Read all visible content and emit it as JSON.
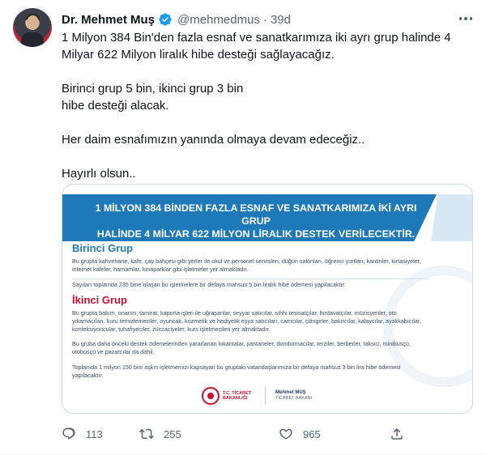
{
  "tweet": {
    "author_name": "Dr. Mehmet Muş",
    "handle": "@mehmedmus",
    "separator": "·",
    "time": "39d",
    "lines": [
      "1 Milyon 384 Bin'den fazla esnaf ve sanatkarımıza iki ayrı grup halinde 4",
      "Milyar 622 Milyon liralık hibe desteği sağlayacağız.",
      "Birinci grup 5 bin, ikinci grup 3 bin",
      "hibe desteği alacak.",
      "Her daim esnafımızın yanında olmaya devam edeceğiz..",
      "Hayırlı olsun.."
    ]
  },
  "media": {
    "banner_line1": "1 MİLYON 384 BİNDEN FAZLA ESNAF VE SANATKARIMIZA İKİ AYRI GRUP",
    "banner_line2": "HALİNDE 4 MİLYAR 622 MİLYON LİRALIK DESTEK VERİLECEKTİR.",
    "group1_title": "Birinci Grup",
    "group1_text": "Bu grupta kahvehane, kafe, çay bahçesi gibi yerler ile okul ve personel servisleri, düğün salonları, öğrenci yurtları, kantinler, kırtasiyeler, internet kafeler, hamamlar, lunaparklar gibi işletmeler yer almaktadır.",
    "group1_note": "Sayıları toplamda 235 bine ulaşan bu işletmelere bir defaya mahsus 5 bin liralık hibe ödemesi yapılacaktır.",
    "group2_title": "İkinci Grup",
    "group2_text": "Bu grupta bakım, onarım, tamirat, kaporta işleri ile uğraşanlar, seyyar satıcılar, sıhhi tesisatçılar, hırdavatçılar, müzisyenler, oto yıkamacıları, kuru temizlemeciler, oyuncak, kozmetik ve hediyelik eşya satıcıları, camcılar, çilingirler, bakırcılar, kalaycılar, ayakkabıcılar, konfeksiyoncular, tuhafiyeciler, züccaciyeler, kurs işletmecileri yer almaktadır.",
    "group2_text2": "Bu gruba daha önceki destek ödemelerinden yararlanan lokantalar, pastaneler, dondurmacılar, terziler, berberler, taksici, minibüsçü, otobüsçü ve pazarcılar da dahil.",
    "group2_note": "Toplamda 1 milyon 150 bini aşkın işletmemizi kapsayan bu gruptaki vatandaşlarımıza bir defaya mahsus 3 bin lira hibe ödemesi yapılacaktır.",
    "logo1_text": "T.C. TİCARET BAKANLIĞI",
    "logo2_name": "Mehmet MUŞ",
    "logo2_title": "TİCARET BAKANI"
  },
  "actions": {
    "replies": "113",
    "retweets": "255",
    "likes": "965"
  },
  "colors": {
    "brand_blue": "#1e79b8",
    "brand_red": "#c8102e",
    "verified_blue": "#1d9bf0",
    "muted": "#536471"
  },
  "icons": [
    "verified-badge-icon",
    "more-icon",
    "reply-icon",
    "retweet-icon",
    "like-icon",
    "share-icon"
  ]
}
